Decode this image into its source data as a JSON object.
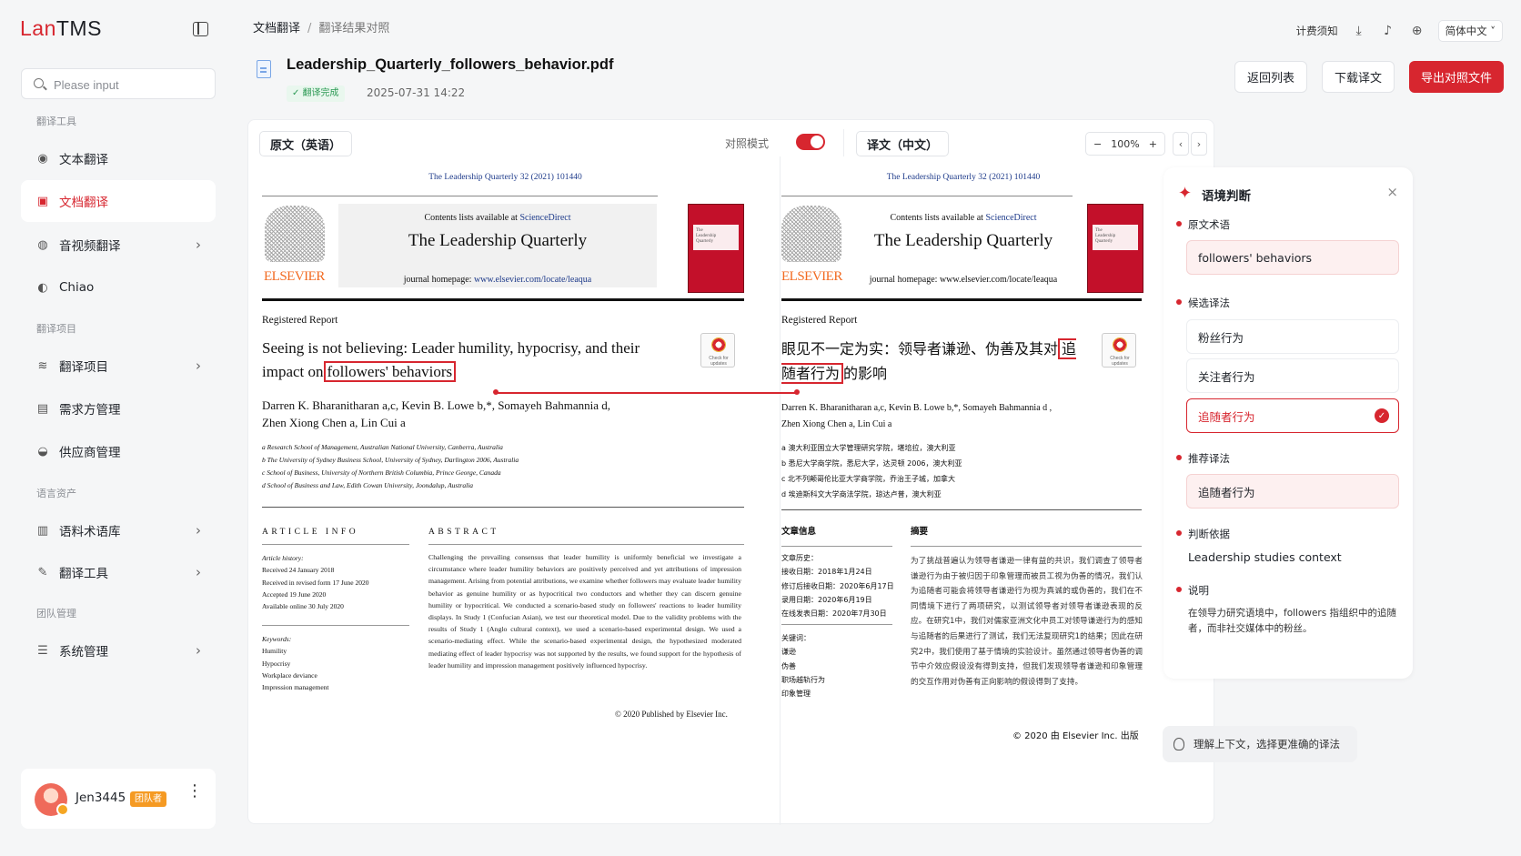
{
  "app": {
    "logo_a": "Lan",
    "logo_b": "TMS"
  },
  "sidebar": {
    "search_placeholder": "Please input",
    "sections": [
      "翻译工具",
      "翻译项目",
      "语言资产",
      "团队管理"
    ],
    "items": [
      {
        "label": "文本翻译",
        "icon": "text-icon"
      },
      {
        "label": "文档翻译",
        "icon": "document-icon",
        "active": true
      },
      {
        "label": "音视频翻译",
        "icon": "audio-video-icon"
      },
      {
        "label": "Chiao",
        "icon": "chiao-icon"
      },
      {
        "label": "翻译项目",
        "icon": "layers-icon"
      },
      {
        "label": "需求方管理",
        "icon": "demand-icon"
      },
      {
        "label": "供应商管理",
        "icon": "supplier-icon"
      },
      {
        "label": "语料术语库",
        "icon": "corpus-icon"
      },
      {
        "label": "翻译工具",
        "icon": "tools-icon"
      },
      {
        "label": "系统管理",
        "icon": "settings-icon"
      }
    ],
    "user": {
      "name": "Jen3445",
      "badge": "团队者"
    }
  },
  "header": {
    "breadcrumb": [
      "文档翻译",
      "翻译结果对照"
    ],
    "billing": "计费须知",
    "language": "简体中文",
    "file_name": "Leadership_Quarterly_followers_behavior.pdf",
    "status": "翻译完成",
    "date": "2025-07-31 14:22",
    "buttons": {
      "back": "返回列表",
      "download": "下载译文",
      "export": "导出对照文件"
    }
  },
  "viewer": {
    "source_label": "原文（英语）",
    "compare_mode": "对照模式",
    "target_label": "译文（中文）",
    "zoom": "100%"
  },
  "source_page": {
    "citation": "The Leadership Quarterly 32 (2021) 101440",
    "publisher": "ELSEVIER",
    "contents_text": "Contents lists available at",
    "sciencedirect": "ScienceDirect",
    "journal_title": "The Leadership Quarterly",
    "homepage_label": "journal homepage:",
    "homepage_url": "www.elsevier.com/locate/leaqua",
    "report_type": "Registered Report",
    "title_pre": "Seeing is not believing: Leader humility, hypocrisy, and their impact on",
    "title_term": "followers' behaviors",
    "authors_line1": "Darren K. Bharanitharan a,c, Kevin B. Lowe b,*, Somayeh Bahmannia d,",
    "authors_line2": "Zhen Xiong Chen a, Lin Cui a",
    "affiliations": [
      "a Research School of Management, Australian National University, Canberra, Australia",
      "b The University of Sydney Business School, University of Sydney, Darlington 2006, Australia",
      "c School of Business, University of Northern British Columbia, Prince George, Canada",
      "d School of Business and Law, Edith Cowan University, Joondalup, Australia"
    ],
    "article_info_head": "ARTICLE INFO",
    "abstract_head": "ABSTRACT",
    "history": [
      "Article history:",
      "Received 24 January 2018",
      "Received in revised form 17 June 2020",
      "Accepted 19 June 2020",
      "Available online 30 July 2020"
    ],
    "keywords": [
      "Keywords:",
      "Humility",
      "Hypocrisy",
      "Workplace deviance",
      "Impression management"
    ],
    "abstract": "Challenging the prevailing consensus that leader humility is uniformly beneficial we investigate a circumstance where leader humility behaviors are positively perceived and yet attributions of impression management. Arising from potential attributions, we examine whether followers may evaluate leader humility behavior as genuine humility or as hypocritical two conductors and whether they can discern genuine humility or hypocritical. We conducted a scenario-based study on followers' reactions to leader humility displays. In Study 1 (Confucian Asian), we test our theoretical model. Due to the validity problems with the results of Study 1 (Anglo cultural context), we used a scenario-based experimental design. We used a scenario-mediating effect. While the scenario-based experimental design, the hypothesized moderated mediating effect of leader hypocrisy was not supported by the results, we found support for the hypothesis of leader humility and impression management positively influenced hypocrisy.",
    "copyright": "© 2020 Published by Elsevier Inc."
  },
  "target_page": {
    "citation": "The Leadership Quarterly 32 (2021) 101440",
    "publisher": "ELSEVIER",
    "contents_text": "Contents lists available at",
    "sciencedirect": "ScienceDirect",
    "journal_title": "The Leadership Quarterly",
    "homepage_label": "journal homepage:",
    "homepage_url": "www.elsevier.com/locate/leaqua",
    "report_type": "Registered Report",
    "title_pre": "眼见不一定为实：领导者谦逊、伪善及其对",
    "title_term": "追随者行为",
    "title_post": "的影响",
    "authors_line1": "Darren K. Bharanitharan a,c, Kevin B. Lowe b,*, Somayeh Bahmannia d ,",
    "authors_line2": "Zhen Xiong Chen a, Lin Cui a",
    "affiliations": [
      "a 澳大利亚国立大学管理研究学院，堪培拉，澳大利亚",
      "b 悉尼大学商学院，悉尼大学，达灵顿 2006，澳大利亚",
      "c 北不列颠哥伦比亚大学商学院，乔治王子城，加拿大",
      "d 埃迪斯科文大学商法学院，琼达卢普，澳大利亚"
    ],
    "article_info_head": "文章信息",
    "abstract_head": "摘要",
    "history": [
      "文章历史：",
      "接收日期：2018年1月24日",
      "修订后接收日期：2020年6月17日",
      "录用日期：2020年6月19日",
      "在线发表日期：2020年7月30日"
    ],
    "keywords": [
      "关键词：",
      "谦逊",
      "伪善",
      "职场越轨行为",
      "印象管理"
    ],
    "abstract": "为了挑战普遍认为领导者谦逊一律有益的共识，我们调查了领导者谦逊行为由于被归因于印象管理而被员工视为伪善的情况，我们认为追随者可能会将领导者谦逊行为视为真诚的或伪善的，我们在不同情境下进行了两项研究，以测试领导者对领导者谦逊表现的反应。在研究1中，我们对儒家亚洲文化中员工对领导谦逊行为的感知与追随者的后果进行了测试，我们无法复现研究1的结果；因此在研究2中，我们使用了基于情境的实验设计。虽然通过领导者伪善的调节中介效应假设没有得到支持，但我们发现领导者谦逊和印象管理的交互作用对伪善有正向影响的假设得到了支持。",
    "copyright": "© 2020 由 Elsevier Inc. 出版"
  },
  "context_panel": {
    "title": "语境判断",
    "source_term_label": "原文术语",
    "source_term": "followers' behaviors",
    "candidates_label": "候选译法",
    "candidates": [
      "粉丝行为",
      "关注者行为",
      "追随者行为"
    ],
    "recommended_label": "推荐译法",
    "recommended": "追随者行为",
    "basis_label": "判断依据",
    "basis": "Leadership studies context",
    "note_label": "说明",
    "note": "在领导力研究语境中，followers 指组织中的追随者，而非社交媒体中的粉丝。"
  },
  "tip": "理解上下文，选择更准确的译法",
  "colors": {
    "accent": "#d7262f",
    "success": "#2d9a55",
    "elsevier_orange": "#f26a21",
    "cover_red": "#c3102a"
  }
}
